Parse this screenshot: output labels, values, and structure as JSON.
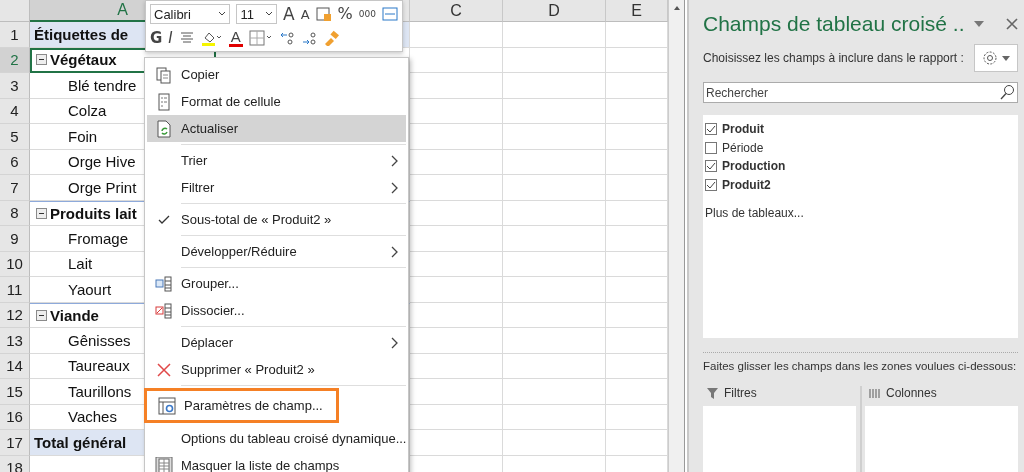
{
  "sheet": {
    "columns": [
      {
        "label": "A",
        "selected": true
      },
      {
        "selected": false
      },
      {
        "label": "C",
        "selected": false
      },
      {
        "label": "D",
        "selected": false
      },
      {
        "label": "E",
        "selected": false
      }
    ],
    "rows": [
      {
        "number": "1",
        "kind": "header",
        "label": "Étiquettes de",
        "selected": false
      },
      {
        "number": "2",
        "kind": "group",
        "label": "Végétaux",
        "selected": true
      },
      {
        "number": "3",
        "kind": "item",
        "label": "Blé tendre",
        "selected": false
      },
      {
        "number": "4",
        "kind": "item",
        "label": "Colza",
        "selected": false
      },
      {
        "number": "5",
        "kind": "item",
        "label": "Foin",
        "selected": false
      },
      {
        "number": "6",
        "kind": "item",
        "label": "Orge Hive",
        "selected": false
      },
      {
        "number": "7",
        "kind": "item",
        "label": "Orge Print",
        "selected": false
      },
      {
        "number": "8",
        "kind": "group",
        "label": "Produits lait",
        "selected": false
      },
      {
        "number": "9",
        "kind": "item",
        "label": "Fromage",
        "selected": false
      },
      {
        "number": "10",
        "kind": "item",
        "label": "Lait",
        "selected": false
      },
      {
        "number": "11",
        "kind": "item",
        "label": "Yaourt",
        "selected": false
      },
      {
        "number": "12",
        "kind": "group",
        "label": "Viande",
        "selected": false
      },
      {
        "number": "13",
        "kind": "item",
        "label": "Gênisses",
        "selected": false
      },
      {
        "number": "14",
        "kind": "item",
        "label": "Taureaux",
        "selected": false
      },
      {
        "number": "15",
        "kind": "item",
        "label": "Taurillons",
        "selected": false
      },
      {
        "number": "16",
        "kind": "item",
        "label": "Vaches",
        "selected": false
      },
      {
        "number": "17",
        "kind": "total",
        "label": "Total général",
        "selected": false
      },
      {
        "number": "18",
        "kind": "empty",
        "selected": false
      }
    ]
  },
  "mini_toolbar": {
    "font": "Calibri",
    "size": "11",
    "grow": "A",
    "shrink": "A",
    "percent": "%",
    "thousands": "000",
    "bold": "G",
    "italic": "I",
    "font_color": "A"
  },
  "context_menu": {
    "items": [
      {
        "kind": "item",
        "label": "Copier",
        "highlighted": false,
        "submenu": false,
        "checked": false,
        "outlined": false
      },
      {
        "kind": "item",
        "label": "Format de cellule",
        "highlighted": false,
        "submenu": false,
        "checked": false,
        "outlined": false
      },
      {
        "kind": "item",
        "label": "Actualiser",
        "highlighted": true,
        "submenu": false,
        "checked": false,
        "outlined": false
      },
      {
        "kind": "separator"
      },
      {
        "kind": "item",
        "label": "Trier",
        "highlighted": false,
        "submenu": true,
        "checked": false,
        "outlined": false
      },
      {
        "kind": "item",
        "label": "Filtrer",
        "highlighted": false,
        "submenu": true,
        "checked": false,
        "outlined": false
      },
      {
        "kind": "separator"
      },
      {
        "kind": "item",
        "label": "Sous-total de « Produit2 »",
        "highlighted": false,
        "submenu": false,
        "checked": true,
        "outlined": false
      },
      {
        "kind": "separator"
      },
      {
        "kind": "item",
        "label": "Développer/Réduire",
        "highlighted": false,
        "submenu": true,
        "checked": false,
        "outlined": false
      },
      {
        "kind": "separator"
      },
      {
        "kind": "item",
        "label": "Grouper...",
        "highlighted": false,
        "submenu": false,
        "checked": false,
        "outlined": false
      },
      {
        "kind": "item",
        "label": "Dissocier...",
        "highlighted": false,
        "submenu": false,
        "checked": false,
        "outlined": false
      },
      {
        "kind": "separator"
      },
      {
        "kind": "item",
        "label": "Déplacer",
        "highlighted": false,
        "submenu": true,
        "checked": false,
        "outlined": false
      },
      {
        "kind": "item",
        "label": "Supprimer « Produit2 »",
        "highlighted": false,
        "submenu": false,
        "checked": false,
        "outlined": false
      },
      {
        "kind": "separator"
      },
      {
        "kind": "item",
        "label": "Paramètres de champ...",
        "highlighted": false,
        "submenu": false,
        "checked": false,
        "outlined": true
      },
      {
        "kind": "item",
        "label": "Options du tableau croisé dynamique...",
        "highlighted": false,
        "submenu": false,
        "checked": false,
        "outlined": false
      },
      {
        "kind": "item",
        "label": "Masquer la liste de champs",
        "highlighted": false,
        "submenu": false,
        "checked": false,
        "outlined": false
      }
    ]
  },
  "panel": {
    "title": "Champs de tableau croisé ..",
    "instruction": "Choisissez les champs à inclure dans le rapport :",
    "search": {
      "placeholder": "Rechercher"
    },
    "fields": [
      {
        "label": "Produit",
        "checked": true
      },
      {
        "label": "Période",
        "checked": false
      },
      {
        "label": "Production",
        "checked": true
      },
      {
        "label": "Produit2",
        "checked": true
      }
    ],
    "more_tables": "Plus de tableaux...",
    "drag_hint": "Faites glisser les champs dans les zones voulues ci-dessous:",
    "areas": [
      {
        "label": "Filtres",
        "kind": "filter"
      },
      {
        "label": "Colonnes",
        "kind": "columns"
      }
    ]
  }
}
